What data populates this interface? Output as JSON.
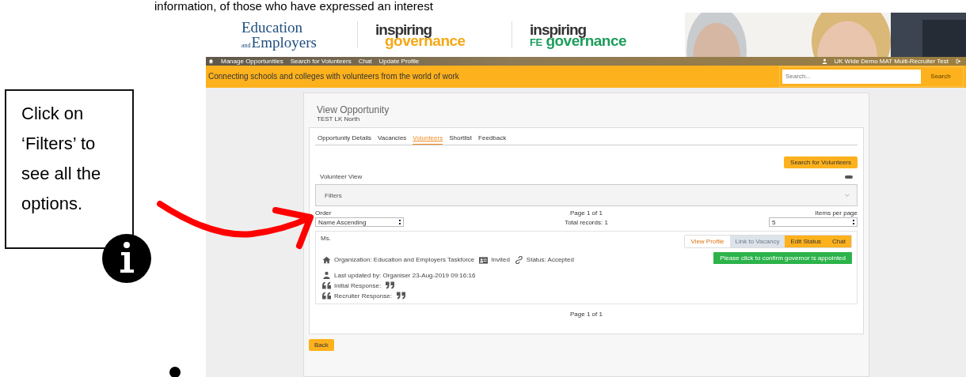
{
  "document": {
    "heading_line": "information, of those who have expressed an interest",
    "callout": "Click on ‘Filters’ to see all the options."
  },
  "logos": [
    {
      "kind": "ee",
      "parts": [
        "Education",
        "and",
        "Employers"
      ]
    },
    {
      "kind": "ig",
      "parts": [
        "inspiring",
        "governance"
      ]
    },
    {
      "kind": "fe",
      "parts": [
        "inspiring",
        "FE",
        "governance"
      ]
    }
  ],
  "nav": {
    "items": [
      {
        "label": "Manage Opportunities",
        "selected": false
      },
      {
        "label": "Search for Volunteers",
        "selected": false
      },
      {
        "label": "Chat",
        "selected": false
      },
      {
        "label": "Update Profile",
        "selected": false
      }
    ],
    "user": "UK Wide Demo MAT Multi-Recruiter Test"
  },
  "banner": {
    "tagline": "Connecting schools and colleges with volunteers from the world of work",
    "search_placeholder": "Search...",
    "search_button": "Search"
  },
  "page": {
    "title": "View Opportunity",
    "subtitle": "TEST LK North",
    "tabs": [
      {
        "label": "Opportunity Details",
        "selected": false
      },
      {
        "label": "Vacancies",
        "selected": false
      },
      {
        "label": "Volunteers",
        "selected": true
      },
      {
        "label": "Shortlist",
        "selected": false
      },
      {
        "label": "Feedback",
        "selected": false
      }
    ],
    "search_button": "Search for Volunteers",
    "section": "Volunteer View",
    "filters": {
      "label": "Filters",
      "expanded": false
    },
    "order_label": "Order",
    "order_value": "Name Ascending",
    "pager": "Page 1 of 1",
    "total": "Total records: 1",
    "per_page_label": "Items per page",
    "per_page_value": "5",
    "record": {
      "name": "Ms.",
      "actions": [
        {
          "label": "View Profile",
          "kind": "outline"
        },
        {
          "label": "Link to Vacancy",
          "kind": "disabled"
        },
        {
          "label": "Edit Status",
          "kind": "primary"
        },
        {
          "label": "Chat",
          "kind": "primary"
        }
      ],
      "confirm_button": "Please click to confirm governor is appointed",
      "organization": "Organization: Education and Employers Taskforce",
      "invited": "Invited",
      "status": "Status: Accepted",
      "updated": "Last updated by: Organiser  23-Aug-2019 09:16:16",
      "initial_response": "Initial Response:",
      "recruiter_response": "Recruiter Response:"
    },
    "footer_pager": "Page 1 of 1",
    "back_button": "Back"
  }
}
